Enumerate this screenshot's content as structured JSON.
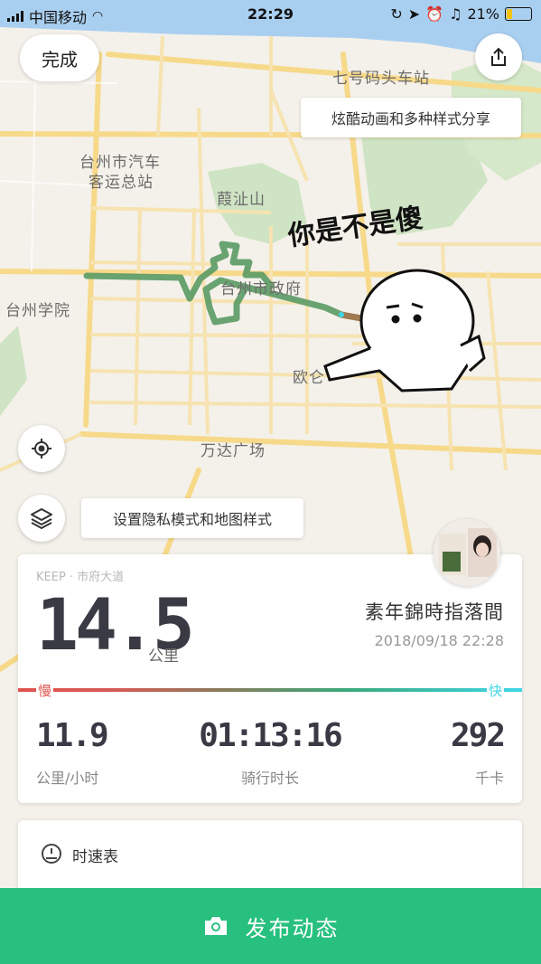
{
  "status_bar": {
    "carrier": "中国移动",
    "time": "22:29",
    "battery": "21%"
  },
  "map": {
    "labels": {
      "pier": "七号码头车站",
      "bus_station_1": "台州市汽车",
      "bus_station_2": "客运总站",
      "mountain": "葭沚山",
      "college": "台州学院",
      "gov": "台州市政府",
      "ou": "欧仑",
      "wanda": "万达广场"
    },
    "sticker_text": "你是不是傻",
    "route_color": "#5a9a64"
  },
  "top": {
    "done_label": "完成",
    "share_tip": "炫酷动画和多种样式分享"
  },
  "map_controls": {
    "privacy_tip": "设置隐私模式和地图样式"
  },
  "summary": {
    "source": "KEEP · 市府大道",
    "distance": "14.5",
    "distance_unit": "公里",
    "username": "素年錦時指落間",
    "datetime": "2018/09/18 22:28",
    "slow_label": "慢",
    "fast_label": "快",
    "avg_speed": "11.9",
    "avg_speed_label": "公里/小时",
    "duration": "01:13:16",
    "duration_label": "骑行时长",
    "calories": "292",
    "calories_label": "千卡"
  },
  "speedometer": {
    "title": "时速表"
  },
  "publish": {
    "label": "发布动态"
  },
  "colors": {
    "accent": "#27c07e",
    "slow": "#e0524e",
    "fast": "#3ed6e6"
  }
}
